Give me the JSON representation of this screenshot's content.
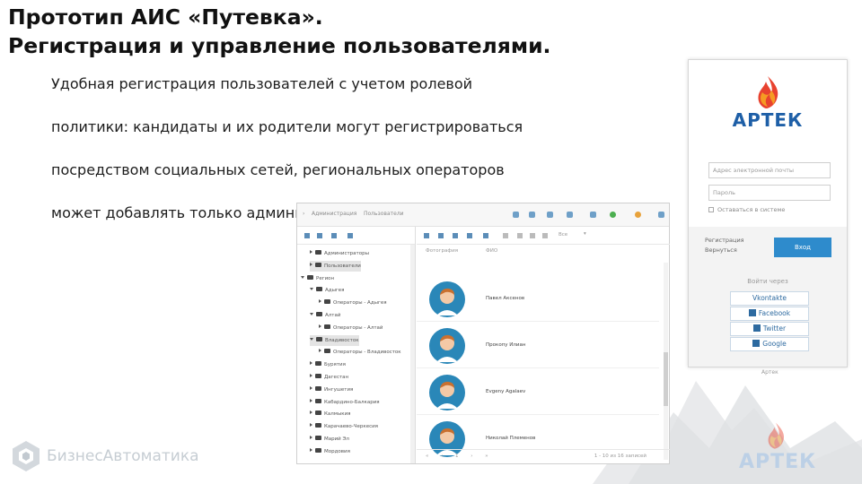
{
  "slide": {
    "title_line1": "Прототип АИС «Путевка».",
    "title_line2": "Регистрация и управление пользователями.",
    "body_lines": [
      "Удобная регистрация пользователей с учетом ролевой",
      "политики: кандидаты и их родители могут регистрироваться",
      "посредством социальных сетей, региональных операторов",
      "может добавлять только администратор системы."
    ]
  },
  "login": {
    "brand": "АРТЕК",
    "email_placeholder": "Адрес электронной почты",
    "password_placeholder": "Пароль",
    "remember_label": "Оставаться в системе",
    "register_text": "Регистрация",
    "register_text2": "Вернуться",
    "login_button": "Вход",
    "social_title": "Войти через",
    "social": [
      "Vkontakte",
      "Facebook",
      "Twitter",
      "Google"
    ],
    "footer": "Артек"
  },
  "app": {
    "crumb1": "Администрация",
    "crumb2": "Пользователи",
    "tree": [
      {
        "label": "Администраторы",
        "level": 1,
        "caret": false,
        "selected": false
      },
      {
        "label": "Пользователи",
        "level": 1,
        "caret": false,
        "selected": true
      },
      {
        "label": "Регион",
        "level": 0,
        "caret": true,
        "selected": false
      },
      {
        "label": "Адыгея",
        "level": 1,
        "caret": true,
        "selected": false
      },
      {
        "label": "Операторы - Адыгея",
        "level": 2,
        "caret": false,
        "selected": false
      },
      {
        "label": "Алтай",
        "level": 1,
        "caret": true,
        "selected": false
      },
      {
        "label": "Операторы - Алтай",
        "level": 2,
        "caret": false,
        "selected": false
      },
      {
        "label": "Владивосток",
        "level": 1,
        "caret": true,
        "selected": true
      },
      {
        "label": "Операторы - Владивосток",
        "level": 2,
        "caret": false,
        "selected": false
      },
      {
        "label": "Бурятия",
        "level": 1,
        "caret": false,
        "selected": false
      },
      {
        "label": "Дагестан",
        "level": 1,
        "caret": false,
        "selected": false
      },
      {
        "label": "Ингушетия",
        "level": 1,
        "caret": false,
        "selected": false
      },
      {
        "label": "Кабардино-Балкария",
        "level": 1,
        "caret": false,
        "selected": false
      },
      {
        "label": "Калмыкия",
        "level": 1,
        "caret": false,
        "selected": false
      },
      {
        "label": "Карачаево-Черкесия",
        "level": 1,
        "caret": false,
        "selected": false
      },
      {
        "label": "Марий Эл",
        "level": 1,
        "caret": false,
        "selected": false
      },
      {
        "label": "Мордовия",
        "level": 1,
        "caret": false,
        "selected": false
      }
    ],
    "toolbar_select": "Все",
    "col_photo": "Фотография",
    "col_fio": "ФИО",
    "users": [
      "Павел Аксенов",
      "Прокопу Илиан",
      "Evgeny Agalaev",
      "Николай Племенов"
    ],
    "pager_info": "1 - 10 из 16 записей",
    "pager_controls": "« ‹ 1 › »"
  },
  "footer_logo": "БизнесАвтоматика",
  "watermark": "АРТЕК"
}
